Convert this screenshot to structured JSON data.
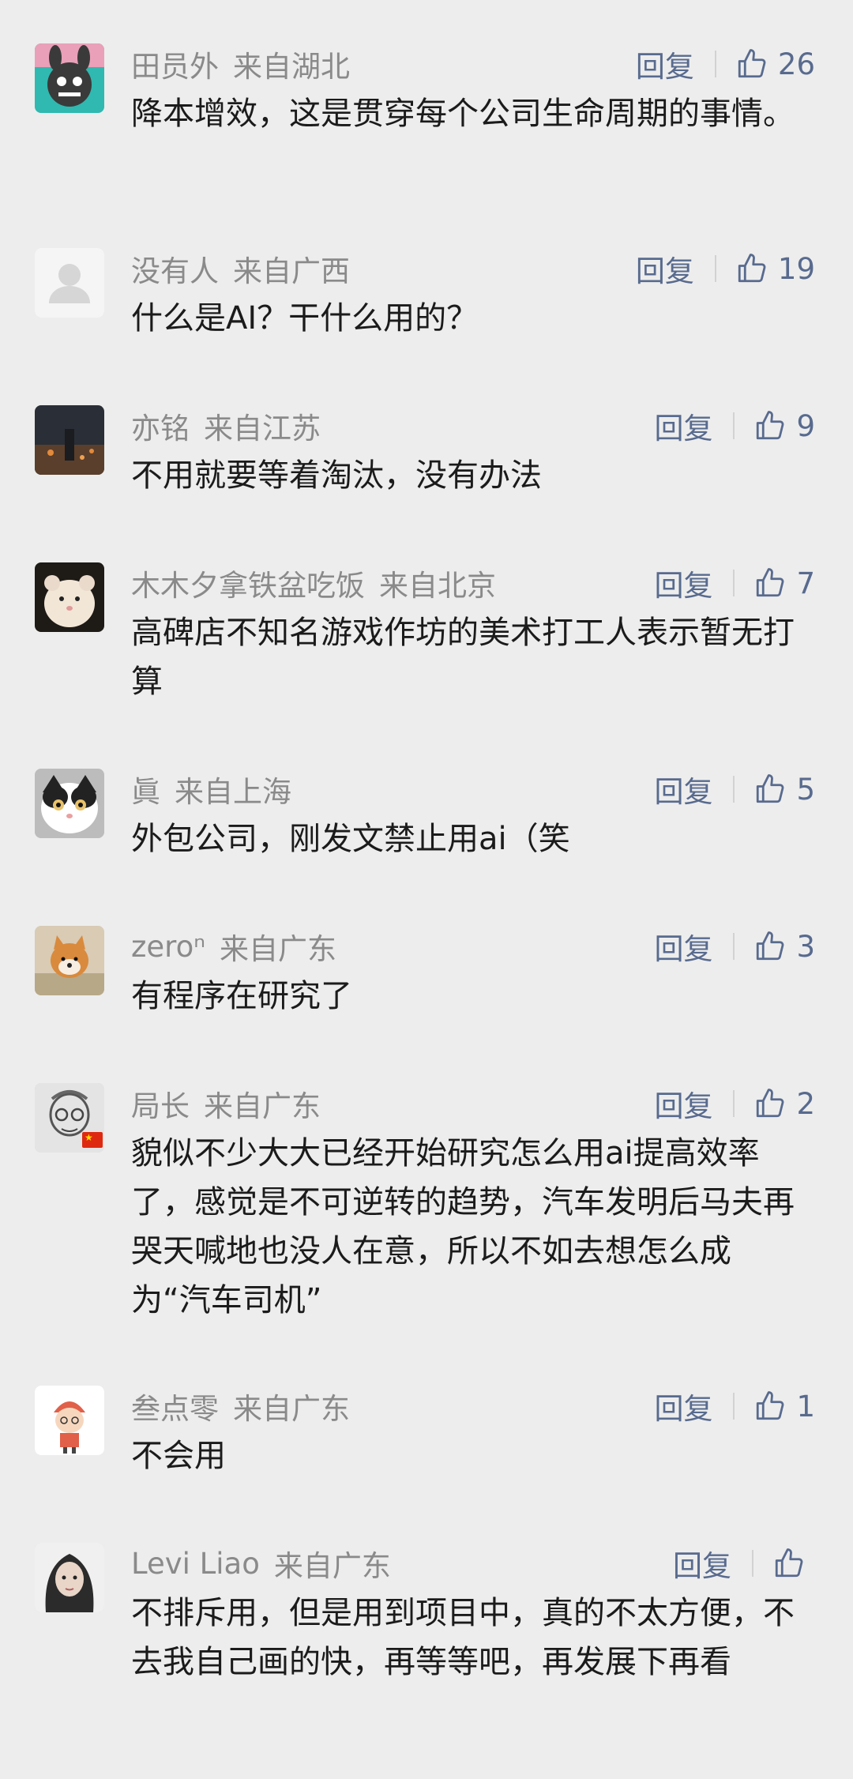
{
  "comments": [
    {
      "name": "田员外",
      "location": "来自湖北",
      "reply": "回复",
      "likes": "26",
      "text": "降本增效，这是贯穿每个公司生命周期的事情。",
      "avatar_icon": "cartoon-rabbit-avatar-icon"
    },
    {
      "name": "没有人",
      "location": "来自广西",
      "reply": "回复",
      "likes": "19",
      "text": "什么是AI？干什么用的？",
      "avatar_icon": "default-person-avatar-icon"
    },
    {
      "name": "亦铭",
      "location": "来自江苏",
      "reply": "回复",
      "likes": "9",
      "text": "不用就要等着淘汰，没有办法",
      "avatar_icon": "night-city-avatar-icon"
    },
    {
      "name": "木木夕拿铁盆吃饭",
      "location": "来自北京",
      "reply": "回复",
      "likes": "7",
      "text": "高碑店不知名游戏作坊的美术打工人表示暂无打算",
      "avatar_icon": "hamster-avatar-icon"
    },
    {
      "name": "眞",
      "location": "来自上海",
      "reply": "回复",
      "likes": "5",
      "text": "外包公司，刚发文禁止用ai（笑",
      "avatar_icon": "cat-avatar-icon"
    },
    {
      "name": "zeroⁿ",
      "location": "来自广东",
      "reply": "回复",
      "likes": "3",
      "text": "有程序在研究了",
      "avatar_icon": "shiba-dog-avatar-icon"
    },
    {
      "name": "局长",
      "location": "来自广东",
      "reply": "回复",
      "likes": "2",
      "text": "貌似不少大大已经开始研究怎么用ai提高效率了，感觉是不可逆转的趋势，汽车发明后马夫再哭天喊地也没人在意，所以不如去想怎么成为“汽车司机”",
      "avatar_icon": "sketch-portrait-avatar-icon",
      "flag_icon": "china-flag-icon"
    },
    {
      "name": "叁点零",
      "location": "来自广东",
      "reply": "回复",
      "likes": "1",
      "text": "不会用",
      "avatar_icon": "cartoon-boy-avatar-icon"
    },
    {
      "name": "Levi Liao",
      "location": "来自广东",
      "reply": "回复",
      "likes": "",
      "text": "不排斥用，但是用到项目中，真的不太方便，不去我自己画的快，再等等吧，再发展下再看",
      "avatar_icon": "girl-portrait-avatar-icon"
    }
  ],
  "colors": {
    "background": "#ededed",
    "name": "#8a8a8a",
    "action": "#586a8e",
    "text": "#1b1b1b"
  }
}
